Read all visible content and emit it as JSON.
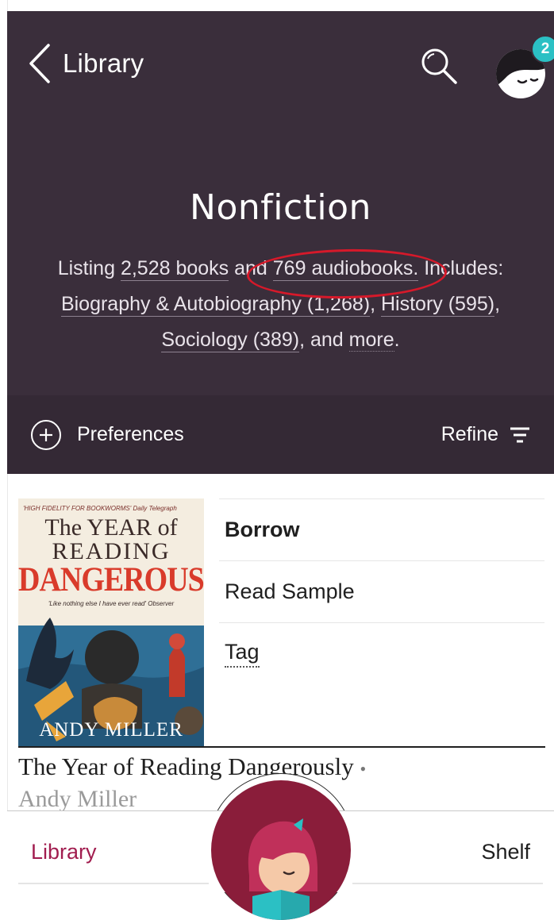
{
  "header": {
    "back_label": "Library",
    "notification_count": "2",
    "title": "Nonfiction",
    "summary": {
      "prefix": "Listing ",
      "books": "2,528 books",
      "and_text_a": " a",
      "and_text_b": "nd ",
      "audiobooks": "769 audiobooks.",
      "includes_text": " Includes:",
      "category1": "Biography & Autobiography (1,268)",
      "sep1": ", ",
      "category2": "History (595)",
      "sep2": ",",
      "category3": "Sociology (389)",
      "and_more_prefix": ", and ",
      "more": "more",
      "period": "."
    }
  },
  "toolbar": {
    "preferences_label": "Preferences",
    "refine_label": "Refine"
  },
  "book": {
    "cover": {
      "quote": "'HIGH FIDELITY FOR BOOKWORMS' Daily Telegraph",
      "line1": "The YEAR of",
      "line2": "READING",
      "line3": "DANGEROUSLY",
      "sub": "'Like nothing else I have ever read' Observer",
      "author": "ANDY MILLER"
    },
    "actions": {
      "borrow": "Borrow",
      "read_sample": "Read Sample",
      "tag": "Tag"
    },
    "title": "The Year of Reading Dangerously",
    "title_bullet": "•",
    "author": "Andy Miller"
  },
  "tabbar": {
    "library_label": "Library",
    "shelf_label": "Shelf"
  },
  "colors": {
    "header_bg": "#3a2e3b",
    "toolbar_bg": "#342935",
    "accent": "#a11d4f",
    "badge": "#2bc0c4",
    "highlight": "#d6192a"
  }
}
